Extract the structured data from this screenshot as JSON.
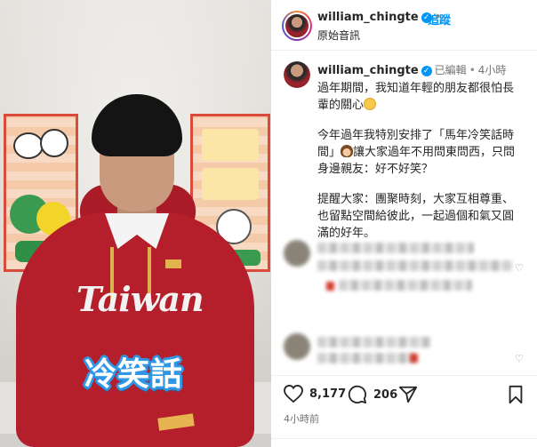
{
  "media": {
    "hoodie_text": "Taiwan",
    "caption_overlay": "冷笑話"
  },
  "header": {
    "username": "william_chingte",
    "follow_label": "追蹤",
    "separator": "•",
    "subtitle": "原始音訊",
    "more_icon": "more-horizontal-icon"
  },
  "post_caption": {
    "username": "william_chingte",
    "edited": "已編輯",
    "separator": "•",
    "time": "4小時",
    "paragraphs": [
      "過年期間，我知道年輕的朋友都很怕長輩的關心",
      "今年過年我特別安排了「馬年冷笑話時間」",
      "讓大家過年不用問東問西，只問身邊親友：好不好笑？",
      "提醒大家：團聚時刻，大家互相尊重、也留點空間給彼此，一起過個和氣又圓滿的好年。"
    ]
  },
  "actions": {
    "likes": "8,177",
    "comments": "206",
    "posted": "4小時前"
  },
  "colors": {
    "accent": "#0095f6",
    "hoodie": "#b51f2b",
    "caption_outline": "#2f97e6"
  }
}
